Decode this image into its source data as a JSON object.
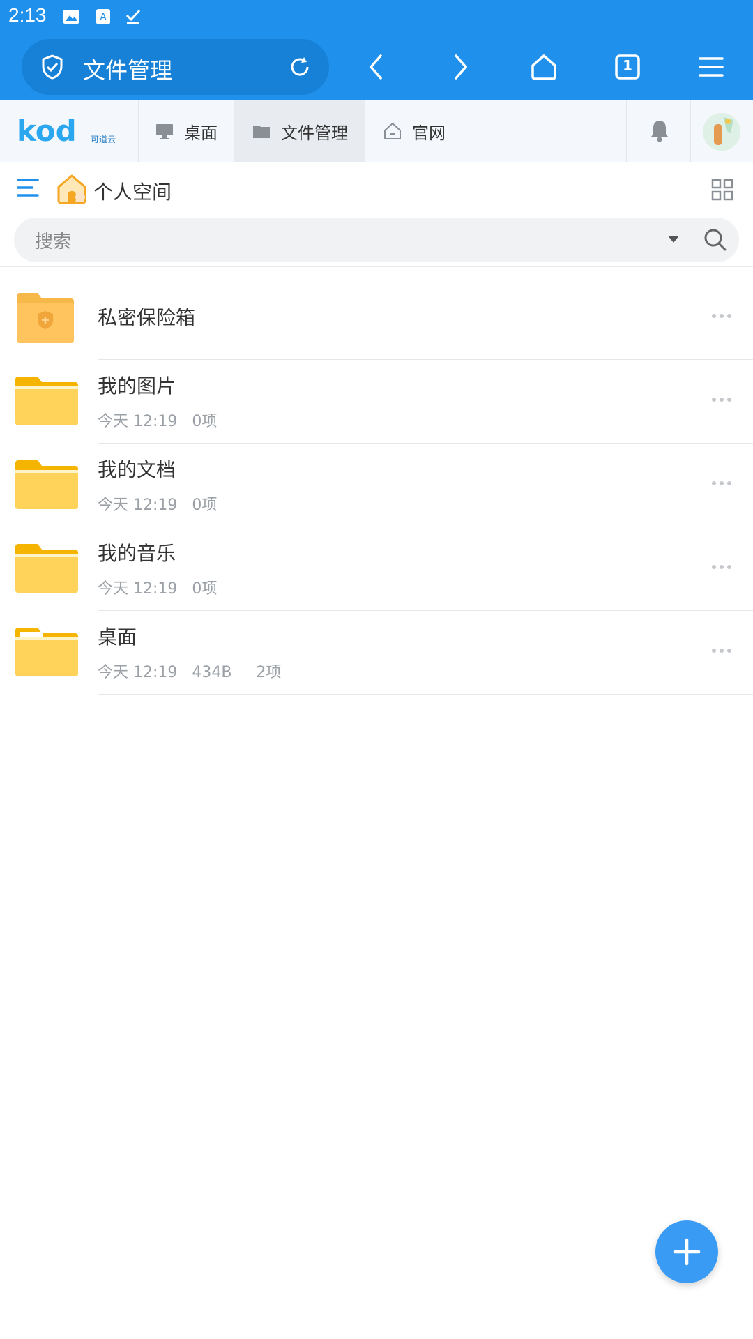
{
  "status_bar": {
    "time": "2:13"
  },
  "browser": {
    "url_title": "文件管理",
    "tab_count": "1"
  },
  "app_header": {
    "tabs": [
      {
        "label": "桌面"
      },
      {
        "label": "文件管理"
      },
      {
        "label": "官网"
      }
    ]
  },
  "path": {
    "current": "个人空间"
  },
  "search": {
    "placeholder": "搜索"
  },
  "files": [
    {
      "name": "私密保险箱",
      "meta": ""
    },
    {
      "name": "我的图片",
      "meta": "今天 12:19   0项"
    },
    {
      "name": "我的文档",
      "meta": "今天 12:19   0项"
    },
    {
      "name": "我的音乐",
      "meta": "今天 12:19   0项"
    },
    {
      "name": "桌面",
      "meta": "今天 12:19   434B     2项"
    }
  ],
  "colors": {
    "primary": "#1f90eb",
    "folder": "#f8c534",
    "fab": "#3a9bf4"
  }
}
